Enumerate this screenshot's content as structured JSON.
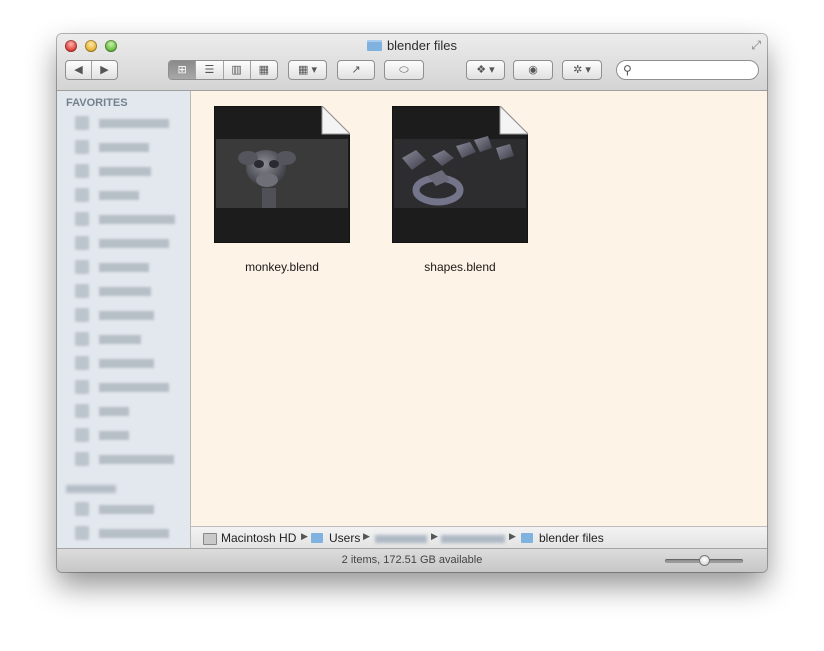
{
  "window": {
    "title": "blender files"
  },
  "toolbar": {
    "back": "◀",
    "forward": "▶",
    "views": [
      "⊞",
      "☰",
      "▥",
      "▦"
    ],
    "arrange": "▦ ▾",
    "share": "↗",
    "tags": "⬭",
    "dropbox": "❖ ▾",
    "quicklook": "◉",
    "action": "✲ ▾",
    "search_placeholder": ""
  },
  "sidebar": {
    "favorites_header": "FAVORITES"
  },
  "files": [
    {
      "name": "monkey.blend",
      "thumb": "blender-thumbnail-icon"
    },
    {
      "name": "shapes.blend",
      "thumb": "blender-thumbnail-icon"
    }
  ],
  "pathbar": {
    "items": [
      "Macintosh HD",
      "Users",
      "blender files"
    ]
  },
  "status": {
    "text": "2 items, 172.51 GB available",
    "icon_size": 0.5
  }
}
